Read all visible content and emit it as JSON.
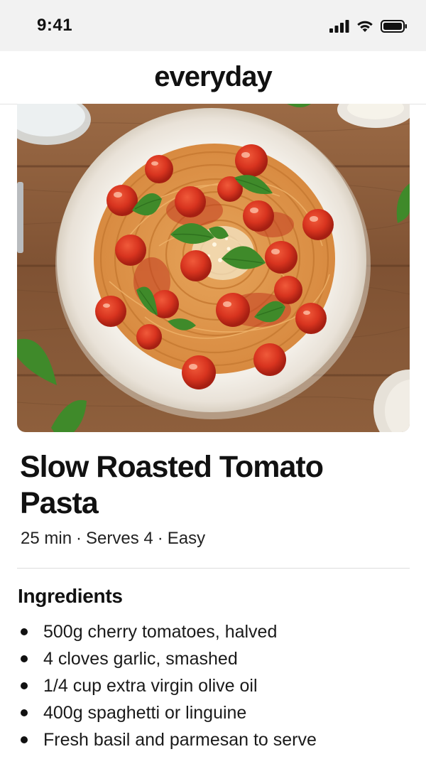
{
  "status_bar": {
    "time": "9:41",
    "icons": [
      "cellular-signal-icon",
      "wifi-icon",
      "battery-icon"
    ]
  },
  "header": {
    "title": "everyday"
  },
  "hero": {
    "image_name": "spaghetti-with-cherry-tomatoes-photo"
  },
  "recipe": {
    "title": "Slow Roasted Tomato Pasta",
    "meta": {
      "time": "25 min",
      "serves": "Serves 4",
      "difficulty": "Easy",
      "separator": "·"
    }
  },
  "ingredients": {
    "heading": "Ingredients",
    "items": [
      "500g cherry tomatoes, halved",
      "4 cloves garlic, smashed",
      "1/4 cup extra virgin olive oil",
      "400g spaghetti or linguine",
      "Fresh basil and parmesan to serve"
    ]
  },
  "colors": {
    "status_bar_bg": "#f2f2f2",
    "text_primary": "#111111",
    "divider": "#dcdcdc",
    "tomato_red": "#d8341f",
    "basil_green": "#3f8a2a",
    "wood": "#8a5a38"
  }
}
